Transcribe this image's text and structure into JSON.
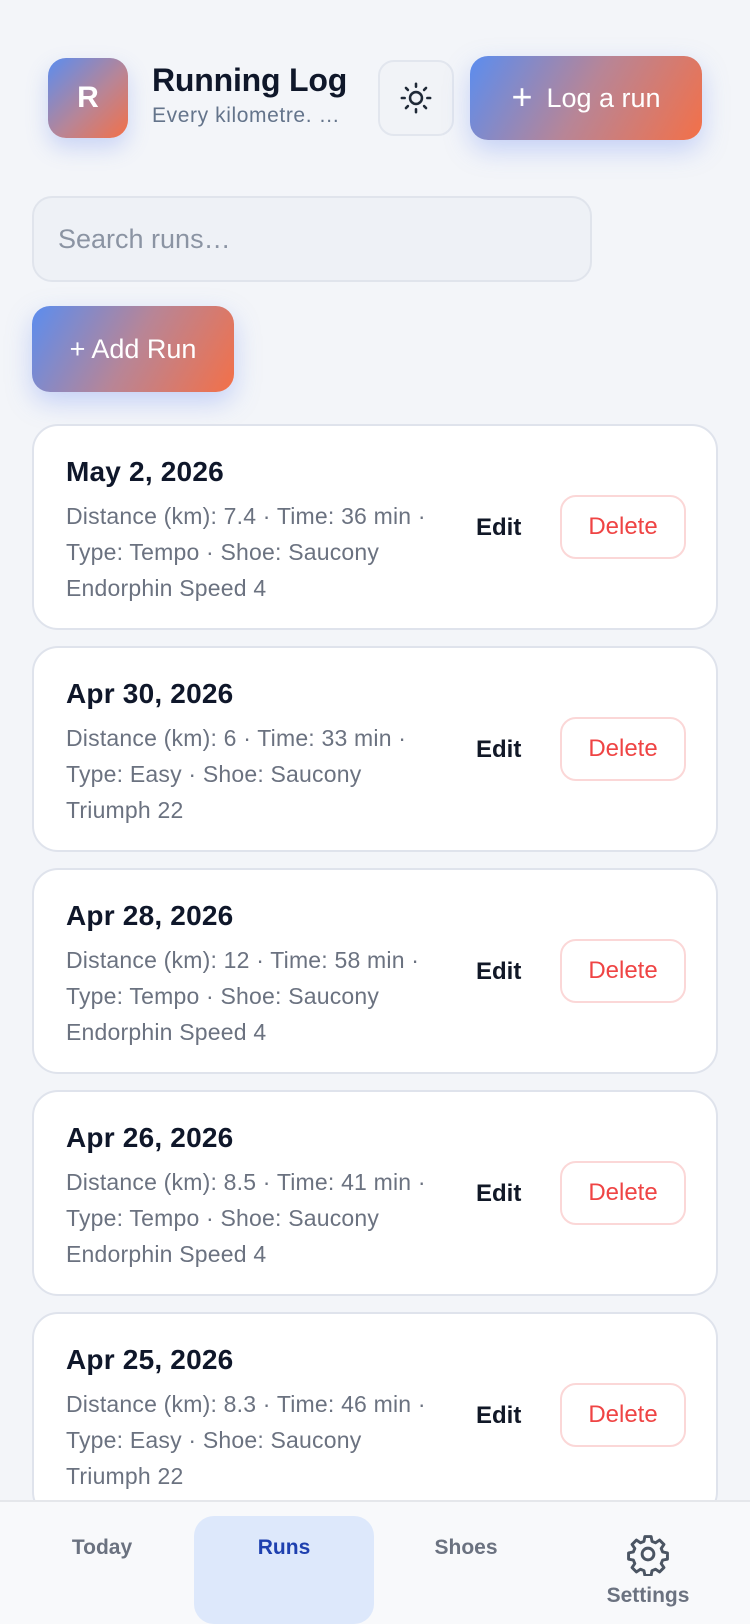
{
  "header": {
    "avatar_letter": "R",
    "title": "Running Log",
    "subtitle": "Every kilometre. …",
    "theme_toggle_icon": "sun-icon",
    "log_run_label": "Log a run",
    "log_run_icon": "plus-icon"
  },
  "search": {
    "placeholder": "Search runs…",
    "value": ""
  },
  "add_run_label": "+ Add Run",
  "runs": [
    {
      "date": "May 2, 2026",
      "details": "Distance (km): 7.4 · Time: 36 min · Type: Tempo · Shoe: Saucony Endorphin Speed 4",
      "edit_label": "Edit",
      "delete_label": "Delete"
    },
    {
      "date": "Apr 30, 2026",
      "details": "Distance (km): 6 · Time: 33 min · Type: Easy · Shoe: Saucony Triumph 22",
      "edit_label": "Edit",
      "delete_label": "Delete"
    },
    {
      "date": "Apr 28, 2026",
      "details": "Distance (km): 12 · Time: 58 min · Type: Tempo · Shoe: Saucony Endorphin Speed 4",
      "edit_label": "Edit",
      "delete_label": "Delete"
    },
    {
      "date": "Apr 26, 2026",
      "details": "Distance (km): 8.5 · Time: 41 min · Type: Tempo · Shoe: Saucony Endorphin Speed 4",
      "edit_label": "Edit",
      "delete_label": "Delete"
    },
    {
      "date": "Apr 25, 2026",
      "details": "Distance (km): 8.3 · Time: 46 min · Type: Easy · Shoe: Saucony Triumph 22",
      "edit_label": "Edit",
      "delete_label": "Delete"
    }
  ],
  "nav": {
    "today": "Today",
    "runs": "Runs",
    "shoes": "Shoes",
    "settings": "Settings",
    "settings_icon": "gear-icon",
    "active": "Runs"
  },
  "colors": {
    "accent_start": "#5b8def",
    "accent_end": "#f37048",
    "delete_red": "#ef4444",
    "active_nav_bg": "#dde8fb",
    "active_nav_text": "#1e40af"
  }
}
